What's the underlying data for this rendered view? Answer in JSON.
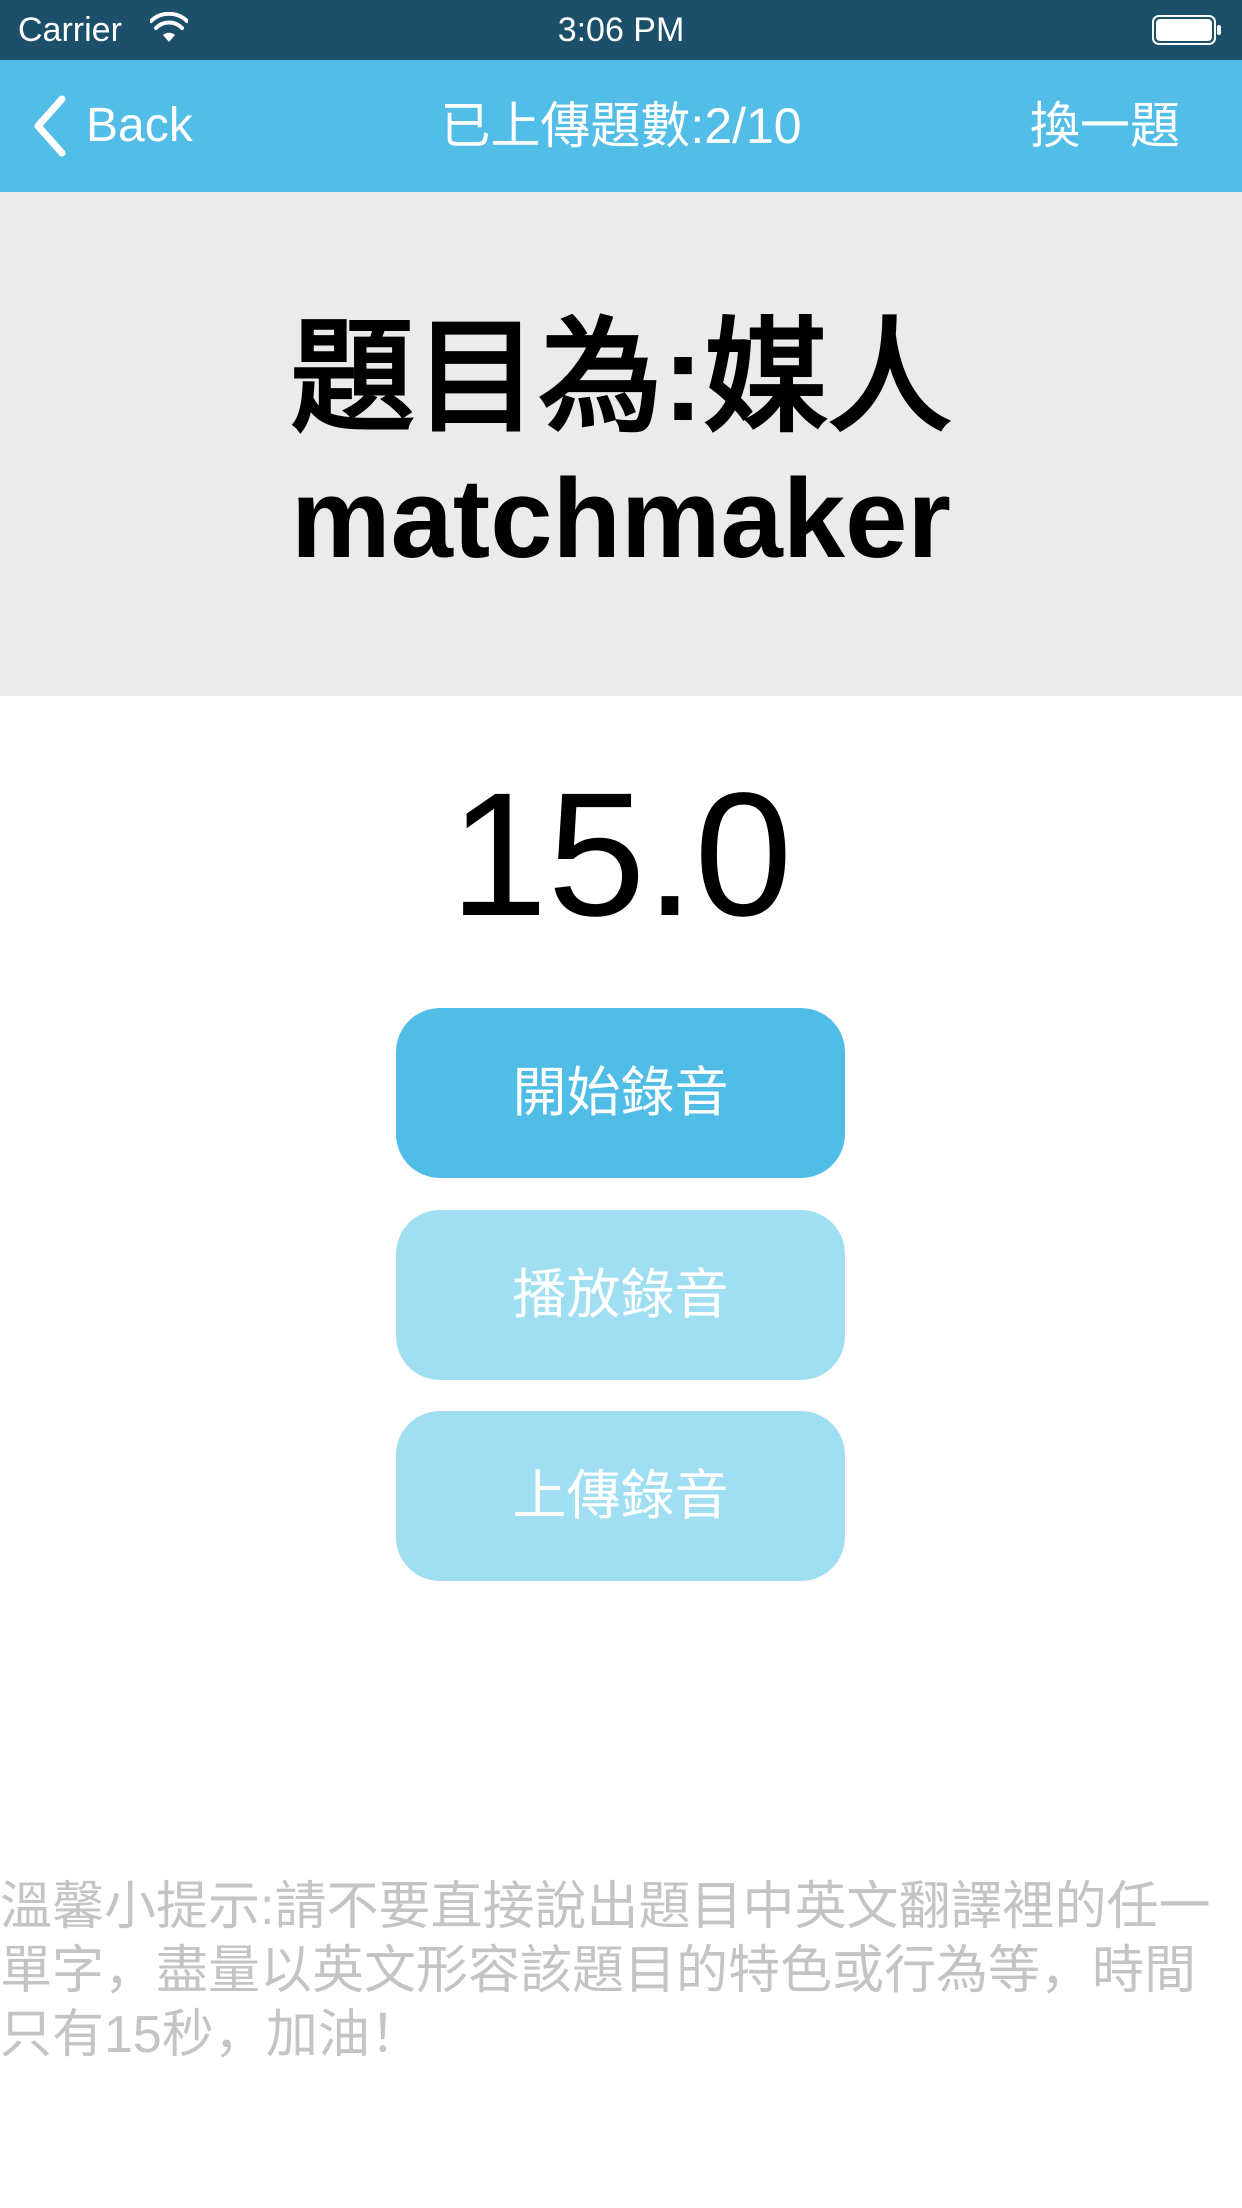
{
  "status_bar": {
    "carrier": "Carrier",
    "time": "3:06 PM"
  },
  "nav": {
    "back_label": "Back",
    "title": "已上傳題數:2/10",
    "skip_label": "換一題"
  },
  "question": {
    "chinese": "題目為:媒人",
    "english": "matchmaker"
  },
  "countdown": "15.0",
  "buttons": {
    "record": "開始錄音",
    "play": "播放錄音",
    "upload": "上傳錄音"
  },
  "tip": "溫馨小提示:請不要直接說出題目中英文翻譯裡的任一單字，盡量以英文形容該題目的特色或行為等，時間只有15秒，加油！",
  "colors": {
    "status_bar": "#1b4f6a",
    "nav_bar": "#52bde6",
    "record_button": "#50bde7",
    "disabled_button": "#a0dff1",
    "question_panel": "#ebebeb",
    "tip_text": "#c4c4c4"
  },
  "icons": [
    "wifi-icon",
    "battery-icon",
    "chevron-left-icon"
  ]
}
